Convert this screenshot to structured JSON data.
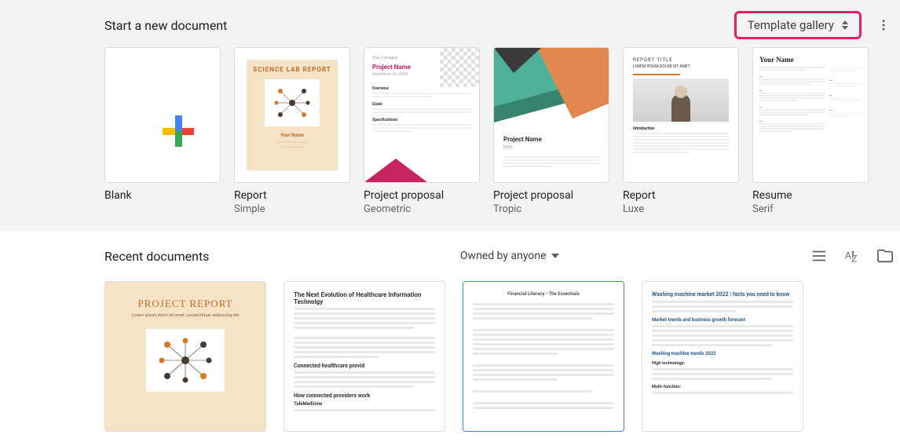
{
  "template_section": {
    "title": "Start a new document",
    "gallery_button": "Template gallery"
  },
  "templates": [
    {
      "name": "Blank",
      "subtitle": ""
    },
    {
      "name": "Report",
      "subtitle": "Simple",
      "thumb_title": "SCIENCE LAB REPORT",
      "thumb_name": "Your Name"
    },
    {
      "name": "Project proposal",
      "subtitle": "Geometric",
      "thumb_company": "Your Company",
      "thumb_project": "Project Name",
      "thumb_date": "September 04, 20XX",
      "thumb_h1": "Overview",
      "thumb_h2": "Goals",
      "thumb_h3": "Specifications"
    },
    {
      "name": "Project proposal",
      "subtitle": "Tropic",
      "thumb_project": "Project Name",
      "thumb_date": "DATE"
    },
    {
      "name": "Report",
      "subtitle": "Luxe",
      "thumb_rt": "REPORT TITLE",
      "thumb_lorem": "LOREM IPSUM DOLOR SIT AMET",
      "thumb_intro": "Introduction"
    },
    {
      "name": "Resume",
      "subtitle": "Serif",
      "thumb_name": "Your Name"
    }
  ],
  "recent": {
    "title": "Recent documents",
    "owned_label": "Owned by anyone"
  },
  "recent_docs": [
    {
      "title": "PROJECT REPORT",
      "subtitle": "Lorem ipsum dolor sit amet, consectetuer adipiscing elit"
    },
    {
      "title": "The Next Evolution of Healthcare Information Technolgy",
      "h1": "Connected healthcare provid",
      "h2": "How connected providers work",
      "h3": "TeleMedicine"
    },
    {
      "title": "Financial Literacy • The Essentials"
    },
    {
      "title": "Washing machine market 2022 | facts you need to know",
      "h1": "Market trends and business growth forecast",
      "h2": "Washing machine trends 2022",
      "h3": "High technology:",
      "h4": "Multi-function:"
    }
  ]
}
